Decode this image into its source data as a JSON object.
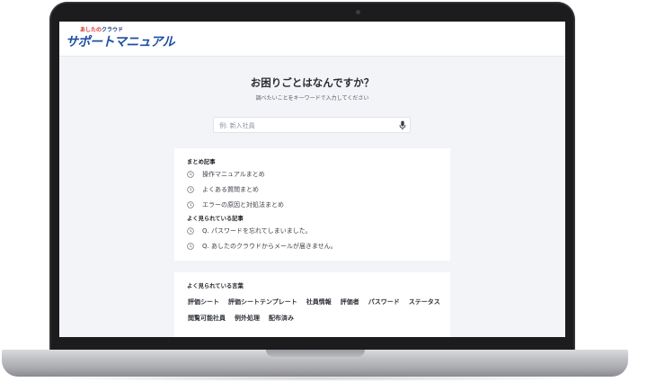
{
  "logo": {
    "small_brand": "あしたの",
    "small_suffix": "クラウド",
    "main": "サポートマニュアル"
  },
  "hero": {
    "title": "お困りごとはなんですか？",
    "subtitle": "調べたいことをキーワードで入力してください"
  },
  "search": {
    "placeholder": "例: 新入社員",
    "value": ""
  },
  "summary": {
    "heading": "まとめ記事",
    "items": [
      {
        "label": "操作マニュアルまとめ",
        "icon": "clock-icon"
      },
      {
        "label": "よくある質問まとめ",
        "icon": "clock-icon"
      },
      {
        "label": "エラーの原因と対処法まとめ",
        "icon": "clock-icon"
      }
    ]
  },
  "popular": {
    "heading": "よく見られている記事",
    "items": [
      {
        "label": "Q. パスワードを忘れてしまいました。",
        "icon": "clock-icon"
      },
      {
        "label": "Q. あしたのクラウドからメールが届きません。",
        "icon": "clock-icon"
      }
    ]
  },
  "keywords": {
    "heading": "よく見られている言葉",
    "row1": [
      "評価シート",
      "評価シートテンプレート",
      "社員情報",
      "評価者",
      "パスワード",
      "ステータス"
    ],
    "row2": [
      "閲覧可能社員",
      "例外処理",
      "配布済み"
    ]
  },
  "colors": {
    "brand_blue": "#1e4fa3",
    "brand_red": "#d8322c",
    "page_bg": "#f2f4f8"
  }
}
